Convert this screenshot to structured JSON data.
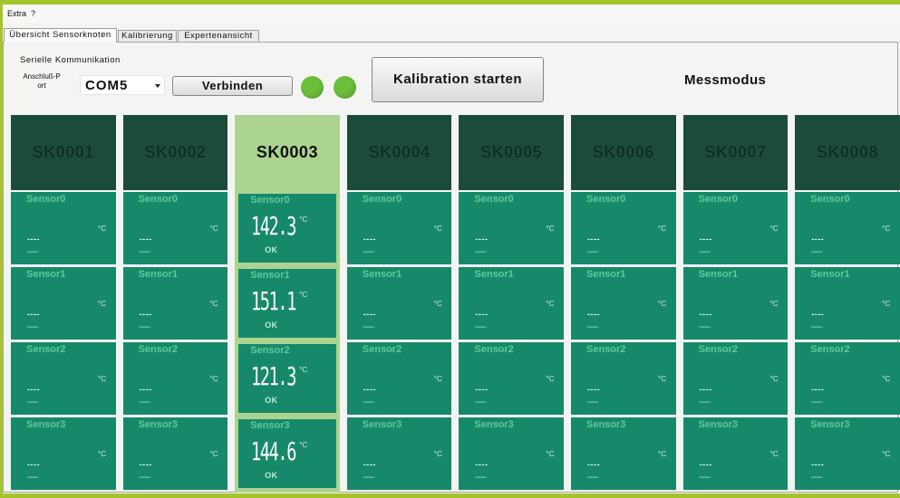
{
  "menu": {
    "items": [
      {
        "label": "Extra"
      },
      {
        "label": "?"
      }
    ]
  },
  "tabs": [
    {
      "label": "Übersicht Sensorknoten",
      "active": true
    },
    {
      "label": "Kalibrierung",
      "active": false
    },
    {
      "label": "Expertenansicht",
      "active": false
    }
  ],
  "serial": {
    "title": "Serielle Kommunikation",
    "port_label": [
      "Anschluß-P",
      "ort"
    ],
    "port_value": "COM5",
    "port_dropdown_icon": "chevron-down-icon",
    "connect_button": "Verbinden",
    "status_leds": [
      {
        "color": "#6cbf3b",
        "on": true
      },
      {
        "color": "#6cbf3b",
        "on": true
      }
    ]
  },
  "calibration_button": "Kalibration starten",
  "mode_label": "Messmodus",
  "colors": {
    "accent_lime": "#a6c42a",
    "node_header": "#1b4c3b",
    "node_header_text": "#0f2d23",
    "sensor_cell": "#17896b",
    "sensor_label": "#5fc99b",
    "highlight": "#abd491"
  },
  "nodes": [
    {
      "name": "SK0001",
      "selected": false,
      "sensors": [
        {
          "label": "Sensor0",
          "value": "----",
          "unit": "°C",
          "status": "—"
        },
        {
          "label": "Sensor1",
          "value": "----",
          "unit": "°C",
          "status": "—"
        },
        {
          "label": "Sensor2",
          "value": "----",
          "unit": "°C",
          "status": "—"
        },
        {
          "label": "Sensor3",
          "value": "----",
          "unit": "°C",
          "status": "—"
        }
      ]
    },
    {
      "name": "SK0002",
      "selected": false,
      "sensors": [
        {
          "label": "Sensor0",
          "value": "----",
          "unit": "°C",
          "status": "—"
        },
        {
          "label": "Sensor1",
          "value": "----",
          "unit": "°C",
          "status": "—"
        },
        {
          "label": "Sensor2",
          "value": "----",
          "unit": "°C",
          "status": "—"
        },
        {
          "label": "Sensor3",
          "value": "----",
          "unit": "°C",
          "status": "—"
        }
      ]
    },
    {
      "name": "SK0003",
      "selected": true,
      "sensors": [
        {
          "label": "Sensor0",
          "value": "142.3",
          "unit": "°C",
          "status": "OK"
        },
        {
          "label": "Sensor1",
          "value": "151.1",
          "unit": "°C",
          "status": "OK"
        },
        {
          "label": "Sensor2",
          "value": "121.3",
          "unit": "°C",
          "status": "OK"
        },
        {
          "label": "Sensor3",
          "value": "144.6",
          "unit": "°C",
          "status": "OK"
        }
      ]
    },
    {
      "name": "SK0004",
      "selected": false,
      "sensors": [
        {
          "label": "Sensor0",
          "value": "----",
          "unit": "°C",
          "status": "—"
        },
        {
          "label": "Sensor1",
          "value": "----",
          "unit": "°C",
          "status": "—"
        },
        {
          "label": "Sensor2",
          "value": "----",
          "unit": "°C",
          "status": "—"
        },
        {
          "label": "Sensor3",
          "value": "----",
          "unit": "°C",
          "status": "—"
        }
      ]
    },
    {
      "name": "SK0005",
      "selected": false,
      "sensors": [
        {
          "label": "Sensor0",
          "value": "----",
          "unit": "°C",
          "status": "—"
        },
        {
          "label": "Sensor1",
          "value": "----",
          "unit": "°C",
          "status": "—"
        },
        {
          "label": "Sensor2",
          "value": "----",
          "unit": "°C",
          "status": "—"
        },
        {
          "label": "Sensor3",
          "value": "----",
          "unit": "°C",
          "status": "—"
        }
      ]
    },
    {
      "name": "SK0006",
      "selected": false,
      "sensors": [
        {
          "label": "Sensor0",
          "value": "----",
          "unit": "°C",
          "status": "—"
        },
        {
          "label": "Sensor1",
          "value": "----",
          "unit": "°C",
          "status": "—"
        },
        {
          "label": "Sensor2",
          "value": "----",
          "unit": "°C",
          "status": "—"
        },
        {
          "label": "Sensor3",
          "value": "----",
          "unit": "°C",
          "status": "—"
        }
      ]
    },
    {
      "name": "SK0007",
      "selected": false,
      "sensors": [
        {
          "label": "Sensor0",
          "value": "----",
          "unit": "°C",
          "status": "—"
        },
        {
          "label": "Sensor1",
          "value": "----",
          "unit": "°C",
          "status": "—"
        },
        {
          "label": "Sensor2",
          "value": "----",
          "unit": "°C",
          "status": "—"
        },
        {
          "label": "Sensor3",
          "value": "----",
          "unit": "°C",
          "status": "—"
        }
      ]
    },
    {
      "name": "SK0008",
      "selected": false,
      "sensors": [
        {
          "label": "Sensor0",
          "value": "----",
          "unit": "°C",
          "status": "—"
        },
        {
          "label": "Sensor1",
          "value": "----",
          "unit": "°C",
          "status": "—"
        },
        {
          "label": "Sensor2",
          "value": "----",
          "unit": "°C",
          "status": "—"
        },
        {
          "label": "Sensor3",
          "value": "----",
          "unit": "°C",
          "status": "—"
        }
      ]
    }
  ]
}
